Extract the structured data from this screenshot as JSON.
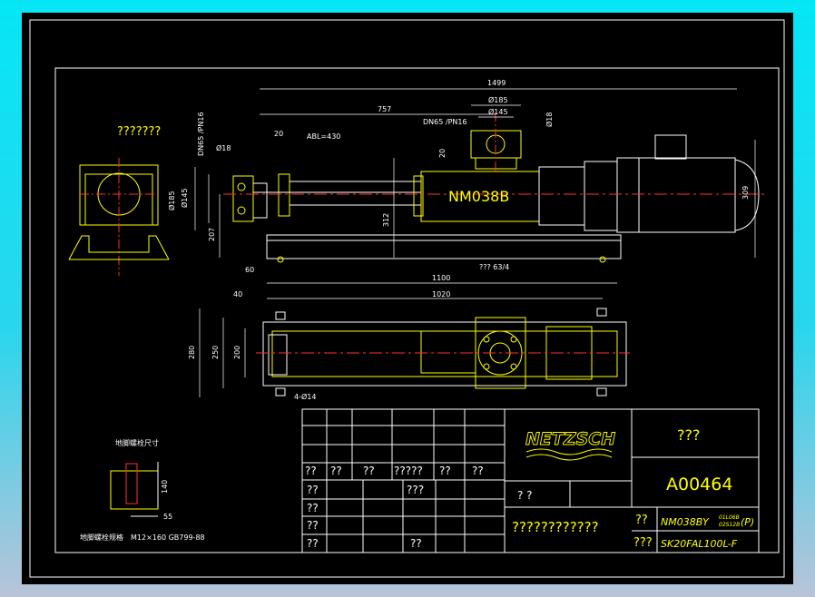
{
  "drawing_title": "NM038B",
  "dimensions": {
    "overall_length": "1499",
    "d757": "757",
    "d185": "Ø185",
    "d145": "Ø145",
    "d18_right": "Ø18",
    "flange_top": "DN65 /PN16",
    "flange_left": "DN65 /PN16",
    "d18_left": "Ø18",
    "d20_left": "20",
    "d20_mid": "20",
    "abl": "ABL=430",
    "d185_left": "Ø185",
    "d145_left": "Ø145",
    "d207": "207",
    "d312": "312",
    "d309": "309",
    "d60": "60",
    "anchor_note": "??? 63/4",
    "d1100": "1100",
    "d1020": "1020",
    "d40": "40",
    "d280": "280",
    "d250": "250",
    "d200": "200",
    "holes": "4-Ø14"
  },
  "view_label": "???????",
  "bolt_detail": {
    "title": "地脚螺栓尺寸",
    "dim_140": "140",
    "dim_55": "55",
    "spec_label": "地脚螺栓规格",
    "spec_value": "M12×160  GB799-88"
  },
  "title_block": {
    "logo": "NETZSCH",
    "rev_labels": [
      "??",
      "??",
      "??",
      "?????",
      "??",
      "??"
    ],
    "row_labels": [
      "??",
      "??",
      "??",
      "??"
    ],
    "mid_label": "???",
    "bottom_mid": "??",
    "scale_label": "?   ?",
    "long_label": "????????????",
    "company": "???",
    "drawing_number": "A00464",
    "model_label": "??",
    "model_value": "NM038BY",
    "model_sup_top": "01L06B",
    "model_sup_bot": "02S12B",
    "model_suffix": "(P)",
    "motor_label": "???",
    "motor_value": "SK20FAL100L-F"
  }
}
